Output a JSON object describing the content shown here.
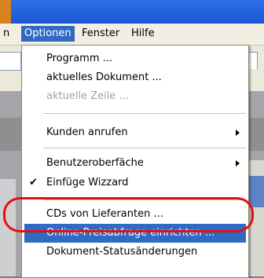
{
  "menubar": {
    "items": [
      {
        "label": "n"
      },
      {
        "label": "Optionen"
      },
      {
        "label": "Fenster"
      },
      {
        "label": "Hilfe"
      }
    ]
  },
  "menu": {
    "items": [
      {
        "label": "Programm ..."
      },
      {
        "label": "aktuelles Dokument ..."
      },
      {
        "label": "aktuelle Zeile ..."
      },
      {
        "label": "Kunden anrufen"
      },
      {
        "label": "Benutzeroberfäche"
      },
      {
        "label": "Einfüge Wizzard",
        "checked": "✔"
      },
      {
        "label": "CDs von Lieferanten ..."
      },
      {
        "label": "Online-Preisabfrage einrichten ..."
      },
      {
        "label": "Dokument-Statusänderungen"
      }
    ]
  },
  "colors": {
    "highlight": "#316ac5",
    "annotation_oval": "#e3110e"
  }
}
